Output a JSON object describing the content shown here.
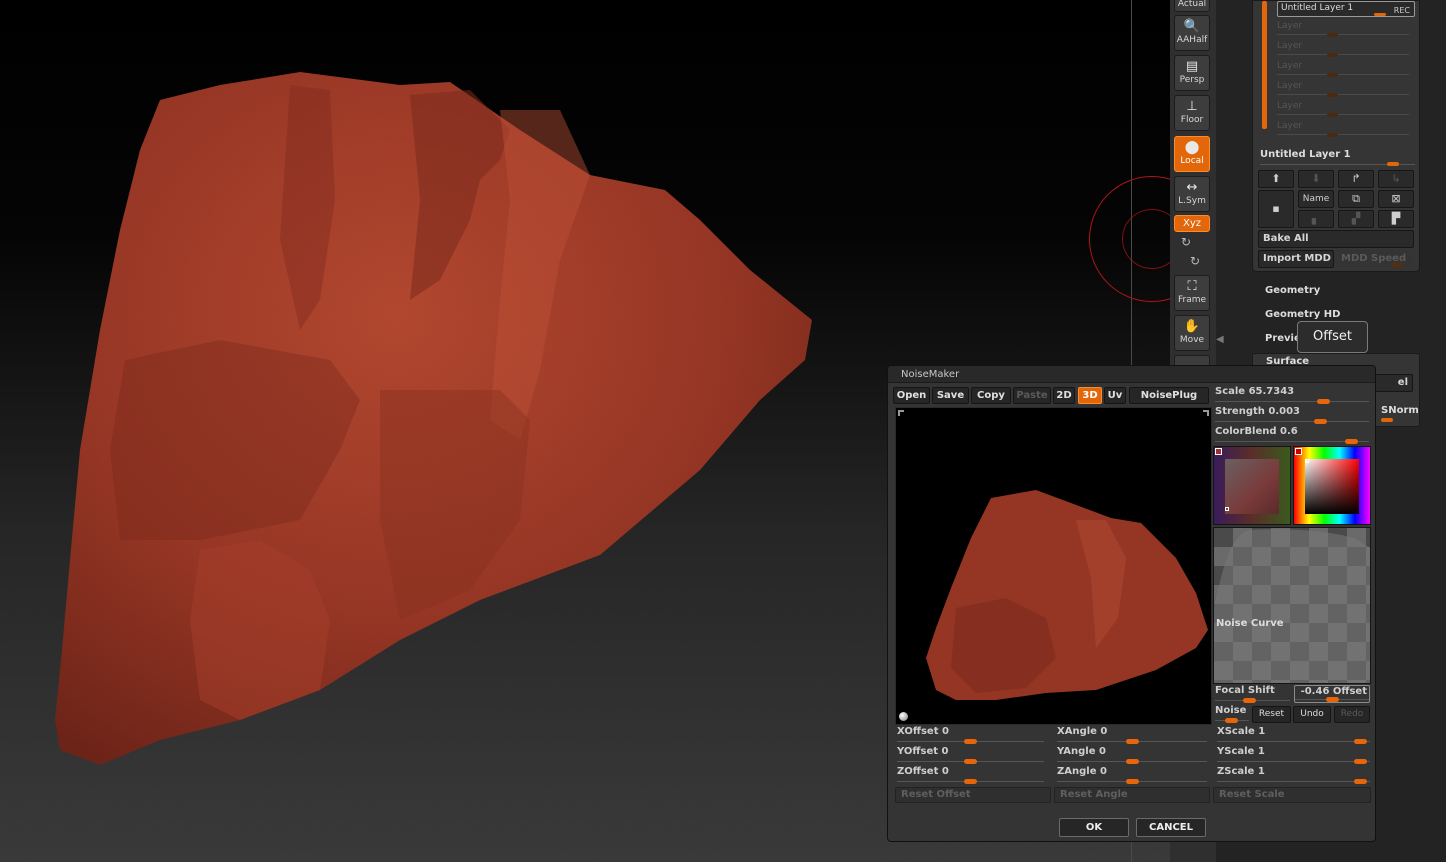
{
  "shelf": {
    "actual": "Actual",
    "aahalf": "AAHalf",
    "persp": "Persp",
    "floor": "Floor",
    "local": "Local",
    "lsym": "L.Sym",
    "xyz": "Xyz",
    "frame": "Frame",
    "move": "Move"
  },
  "layers": {
    "active_layer": "Untitled Layer 1",
    "rec": "REC",
    "placeholder_layers": [
      "Layer",
      "Layer",
      "Layer",
      "Layer",
      "Layer",
      "Layer"
    ],
    "current_layer": "Untitled Layer 1",
    "name_button": "Name",
    "bake_all": "Bake All",
    "import_mdd": "Import MDD",
    "mdd_speed": "MDD Speed"
  },
  "subtool_menu": {
    "geometry": "Geometry",
    "geometry_hd": "Geometry HD",
    "preview": "Preview",
    "surface": "Surface",
    "noise_partial": "el",
    "snorm_partial": "SNorm"
  },
  "tooltip": "Offset",
  "noisemaker": {
    "title": "NoiseMaker",
    "toolbar": {
      "open": "Open",
      "save": "Save",
      "copy": "Copy",
      "paste": "Paste",
      "mode_2d": "2D",
      "mode_3d": "3D",
      "uv": "Uv",
      "noiseplug": "NoisePlug"
    },
    "scale": {
      "label": "Scale",
      "value": "65.7343",
      "level": 0.72
    },
    "strength": {
      "label": "Strength",
      "value": "0.003",
      "level": 0.7
    },
    "colorblend": {
      "label": "ColorBlend",
      "value": "0.6",
      "level": 0.92
    },
    "noise_curve_label": "Noise Curve",
    "focal_shift": {
      "label": "Focal Shift",
      "level": 0.45
    },
    "offset": {
      "label": "-0.46 Offset",
      "level": 0.5
    },
    "noise_label": "Noise",
    "reset": "Reset",
    "undo": "Undo",
    "redo": "Redo",
    "xoffset": {
      "label": "XOffset",
      "value": "0",
      "level": 0.5
    },
    "yoffset": {
      "label": "YOffset",
      "value": "0",
      "level": 0.5
    },
    "zoffset": {
      "label": "ZOffset",
      "value": "0",
      "level": 0.5
    },
    "xangle": {
      "label": "XAngle",
      "value": "0",
      "level": 0.5
    },
    "yangle": {
      "label": "YAngle",
      "value": "0",
      "level": 0.5
    },
    "zangle": {
      "label": "ZAngle",
      "value": "0",
      "level": 0.5
    },
    "xscale": {
      "label": "XScale",
      "value": "1",
      "level": 0.98
    },
    "yscale": {
      "label": "YScale",
      "value": "1",
      "level": 0.98
    },
    "zscale": {
      "label": "ZScale",
      "value": "1",
      "level": 0.98
    },
    "reset_offset": "Reset Offset",
    "reset_angle": "Reset Angle",
    "reset_scale": "Reset Scale",
    "ok": "OK",
    "cancel": "CANCEL"
  },
  "colors": {
    "accent": "#e2670a",
    "rock": "#9a3626"
  }
}
